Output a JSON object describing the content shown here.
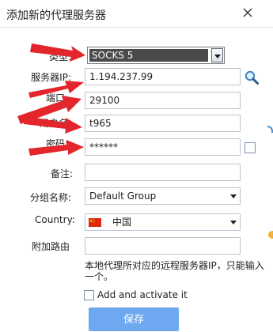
{
  "dialog": {
    "title": "添加新的代理服务器",
    "close_glyph": "✕"
  },
  "form": {
    "type_label": "类型:",
    "type_value": "SOCKS 5",
    "server_label": "服务器IP:",
    "server_value": "1.194.237.99",
    "port_label": "端口:",
    "port_value": "29100",
    "username_label": "用户名:",
    "username_value": "t965",
    "password_label": "密码:",
    "password_value": "******",
    "note_label": "备注:",
    "note_value": "",
    "group_label": "分组名称:",
    "group_value": "Default Group",
    "country_label": "Country:",
    "country_value": "中国",
    "route_label": "附加路由",
    "route_value": "",
    "route_hint": "本地代理所对应的远程服务器IP，只能输入一个。",
    "activate_label": "Add and activate it",
    "save_label": "保存"
  },
  "colors": {
    "accent_button": "#6ea8f0",
    "annotation_arrow": "#e3262b",
    "input_border": "#b9c4d2"
  },
  "icons": {
    "search": "magnifier-icon",
    "flag": "china-flag-icon",
    "close": "close-icon"
  }
}
